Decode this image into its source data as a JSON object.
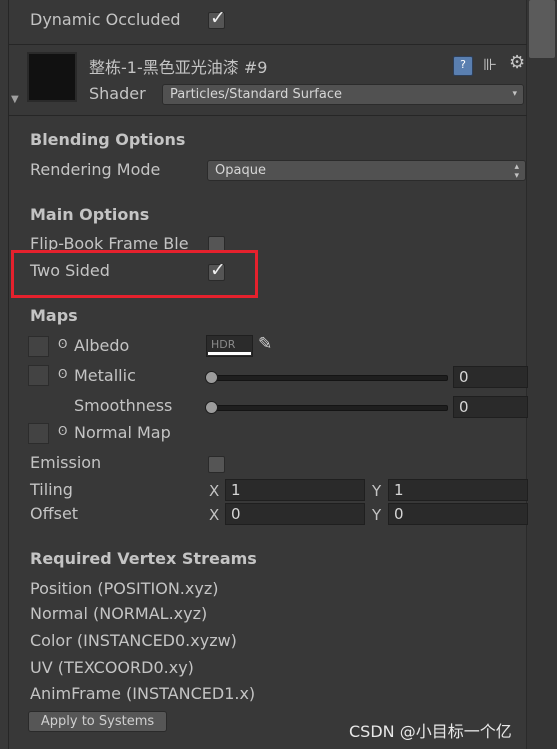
{
  "renderer": {
    "dynamic_occluded_label": "Dynamic Occluded",
    "dynamic_occluded_checked": true
  },
  "material": {
    "name": "整栋-1-黑色亚光油漆 #9",
    "shader_label": "Shader",
    "shader_value": "Particles/Standard Surface",
    "icons": [
      "help-book-icon",
      "preset-sliders-icon",
      "gear-icon"
    ]
  },
  "blending": {
    "title": "Blending Options",
    "rendering_mode_label": "Rendering Mode",
    "rendering_mode_value": "Opaque"
  },
  "main_options": {
    "title": "Main Options",
    "flip_book_label": "Flip-Book Frame Ble",
    "flip_book_checked": false,
    "two_sided_label": "Two Sided",
    "two_sided_checked": true
  },
  "maps": {
    "title": "Maps",
    "albedo_label": "Albedo",
    "albedo_hdr": "HDR",
    "metallic_label": "Metallic",
    "metallic_value": "0",
    "smoothness_label": "Smoothness",
    "smoothness_value": "0",
    "normal_map_label": "Normal Map",
    "emission_label": "Emission",
    "emission_checked": false,
    "tiling_label": "Tiling",
    "tiling_x_label": "X",
    "tiling_x": "1",
    "tiling_y_label": "Y",
    "tiling_y": "1",
    "offset_label": "Offset",
    "offset_x_label": "X",
    "offset_x": "0",
    "offset_y_label": "Y",
    "offset_y": "0"
  },
  "vertex_streams": {
    "title": "Required Vertex Streams",
    "items": [
      "Position (POSITION.xyz)",
      "Normal (NORMAL.xyz)",
      "Color (INSTANCED0.xyzw)",
      "UV (TEXCOORD0.xy)",
      "AnimFrame (INSTANCED1.x)"
    ],
    "apply_button": "Apply to Systems"
  },
  "watermark": "CSDN @小目标一个亿",
  "colors": {
    "highlight": "#e5212d",
    "background": "#383838"
  }
}
